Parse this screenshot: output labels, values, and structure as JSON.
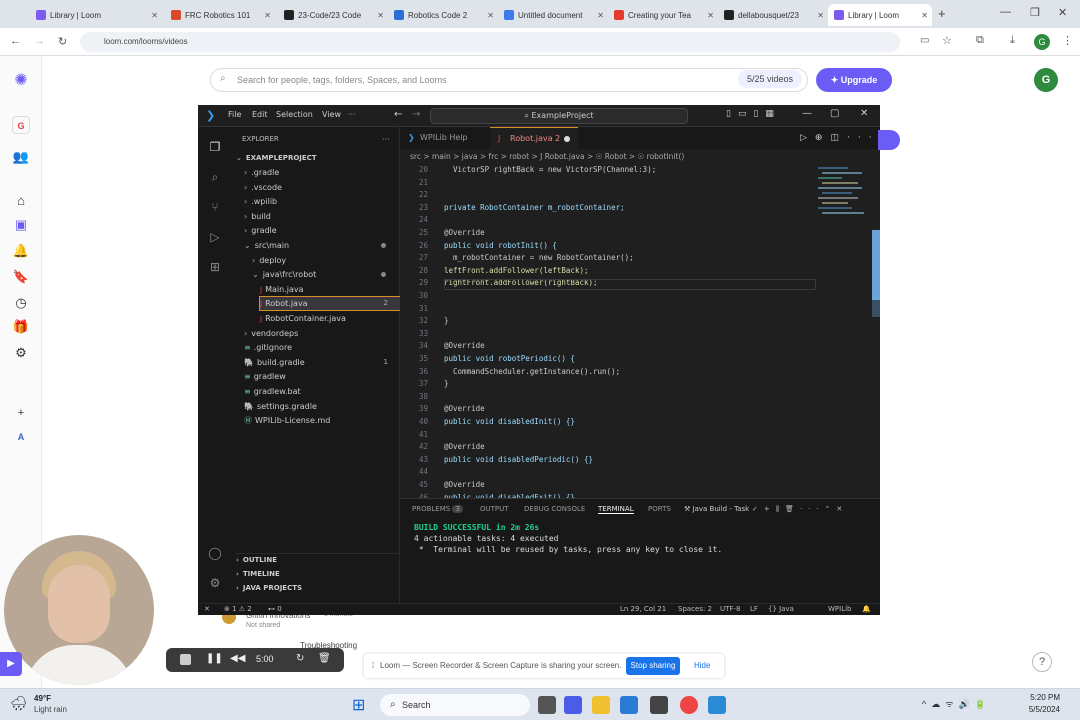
{
  "browser": {
    "tabs": [
      {
        "label": "Library | Loom",
        "color": "#7c5cf0"
      },
      {
        "label": "FRC Robotics 101",
        "color": "#d84a2a"
      },
      {
        "label": "23-Code/23 Code",
        "color": "#222222"
      },
      {
        "label": "Robotics Code 2",
        "color": "#2b6fd6"
      },
      {
        "label": "Untitled document",
        "color": "#3b7bea"
      },
      {
        "label": "Creating your Tea",
        "color": "#e33b2a"
      },
      {
        "label": "dellabousquet/23",
        "color": "#222222"
      },
      {
        "label": "Library | Loom",
        "color": "#7c5cf0"
      }
    ],
    "url": "loom.com/looms/videos"
  },
  "loom": {
    "search_placeholder": "Search for people, tags, folders, Spaces, and Looms",
    "videos_count": "5/25 videos",
    "upgrade_label": "Upgrade",
    "avatar_letter": "G",
    "workspace_letter": "G",
    "workspace_small": "A",
    "bg_card_author": "Griffin Innovations",
    "bg_card_sub": "Not shared",
    "bg_card_meta": "3 months",
    "bg_card_title": "Troubleshooting"
  },
  "vscode": {
    "menu": [
      "File",
      "Edit",
      "Selection",
      "View"
    ],
    "command_center": "ExampleProject",
    "explorer_header": "EXPLORER",
    "project": "EXAMPLEPROJECT",
    "tree": [
      {
        "label": ".gradle",
        "indent": 1,
        "kind": "folder"
      },
      {
        "label": ".vscode",
        "indent": 1,
        "kind": "folder"
      },
      {
        "label": ".wpilib",
        "indent": 1,
        "kind": "folder"
      },
      {
        "label": "build",
        "indent": 1,
        "kind": "folder"
      },
      {
        "label": "gradle",
        "indent": 1,
        "kind": "folder"
      },
      {
        "label": "src\\main",
        "indent": 1,
        "kind": "open",
        "dot": true
      },
      {
        "label": "deploy",
        "indent": 2,
        "kind": "folder"
      },
      {
        "label": "java\\frc\\robot",
        "indent": 2,
        "kind": "open",
        "dot": true
      },
      {
        "label": "Main.java",
        "indent": 3,
        "kind": "java"
      },
      {
        "label": "Robot.java",
        "indent": 3,
        "kind": "java",
        "count": "2"
      },
      {
        "label": "RobotContainer.java",
        "indent": 3,
        "kind": "java"
      },
      {
        "label": "vendordeps",
        "indent": 1,
        "kind": "folder"
      },
      {
        "label": ".gitignore",
        "indent": 1,
        "kind": "file"
      },
      {
        "label": "build.gradle",
        "indent": 1,
        "kind": "gradle",
        "count": "1"
      },
      {
        "label": "gradlew",
        "indent": 1,
        "kind": "file"
      },
      {
        "label": "gradlew.bat",
        "indent": 1,
        "kind": "file"
      },
      {
        "label": "settings.gradle",
        "indent": 1,
        "kind": "gradle"
      },
      {
        "label": "WPILib-License.md",
        "indent": 1,
        "kind": "md"
      }
    ],
    "outline": "OUTLINE",
    "timeline": "TIMELINE",
    "java_projects": "JAVA PROJECTS",
    "editor_tabs": [
      {
        "label": "WPILib Help",
        "active": false
      },
      {
        "label": "Robot.java 2",
        "active": true
      }
    ],
    "breadcrumb": "src > main > java > frc > robot > J Robot.java > ☉ Robot > ☉ robotInit()",
    "code": [
      {
        "n": "20",
        "t": "  VictorSP rightBack = new VictorSP(Channel:3);"
      },
      {
        "n": "21",
        "t": ""
      },
      {
        "n": "22",
        "t": ""
      },
      {
        "n": "23",
        "t": "private RobotContainer m_robotContainer;"
      },
      {
        "n": "24",
        "t": ""
      },
      {
        "n": "25",
        "t": "@Override"
      },
      {
        "n": "26",
        "t": "public void robotInit() {"
      },
      {
        "n": "27",
        "t": "  m_robotContainer = new RobotContainer();"
      },
      {
        "n": "28",
        "t": "leftFront.addFollower(leftBack);"
      },
      {
        "n": "29",
        "t": "rightFront.addFollower(rightBack);"
      },
      {
        "n": "30",
        "t": ""
      },
      {
        "n": "31",
        "t": ""
      },
      {
        "n": "32",
        "t": "}"
      },
      {
        "n": "33",
        "t": ""
      },
      {
        "n": "34",
        "t": "@Override"
      },
      {
        "n": "35",
        "t": "public void robotPeriodic() {"
      },
      {
        "n": "36",
        "t": "  CommandScheduler.getInstance().run();"
      },
      {
        "n": "37",
        "t": "}"
      },
      {
        "n": "38",
        "t": ""
      },
      {
        "n": "39",
        "t": "@Override"
      },
      {
        "n": "40",
        "t": "public void disabledInit() {}"
      },
      {
        "n": "41",
        "t": ""
      },
      {
        "n": "42",
        "t": "@Override"
      },
      {
        "n": "43",
        "t": "public void disabledPeriodic() {}"
      },
      {
        "n": "44",
        "t": ""
      },
      {
        "n": "45",
        "t": "@Override"
      },
      {
        "n": "46",
        "t": "public void disabledExit() {}"
      }
    ],
    "panel_tabs": [
      "PROBLEMS",
      "OUTPUT",
      "DEBUG CONSOLE",
      "TERMINAL",
      "PORTS"
    ],
    "problems_count": "3",
    "task_label": "Java Build - Task",
    "terminal": [
      "BUILD SUCCESSFUL in 2m 26s",
      "4 actionable tasks: 4 executed",
      " *  Terminal will be reused by tasks, press any key to close it."
    ],
    "status": {
      "errors": "⊗ 1 ⚠ 2",
      "ports": "⊷ 0",
      "position": "Ln 29, Col 21",
      "spaces": "Spaces: 2",
      "encoding": "UTF-8",
      "eol": "LF",
      "language": "{} Java",
      "wpilib": "WPILib"
    }
  },
  "recorder": {
    "time": "5:00"
  },
  "share_bar": {
    "message": "Loom — Screen Recorder & Screen Capture is sharing your screen.",
    "stop_label": "Stop sharing",
    "hide_label": "Hide"
  },
  "taskbar": {
    "weather_temp": "49°F",
    "weather_desc": "Light rain",
    "search_label": "Search",
    "time": "5:20 PM",
    "date": "5/5/2024"
  }
}
